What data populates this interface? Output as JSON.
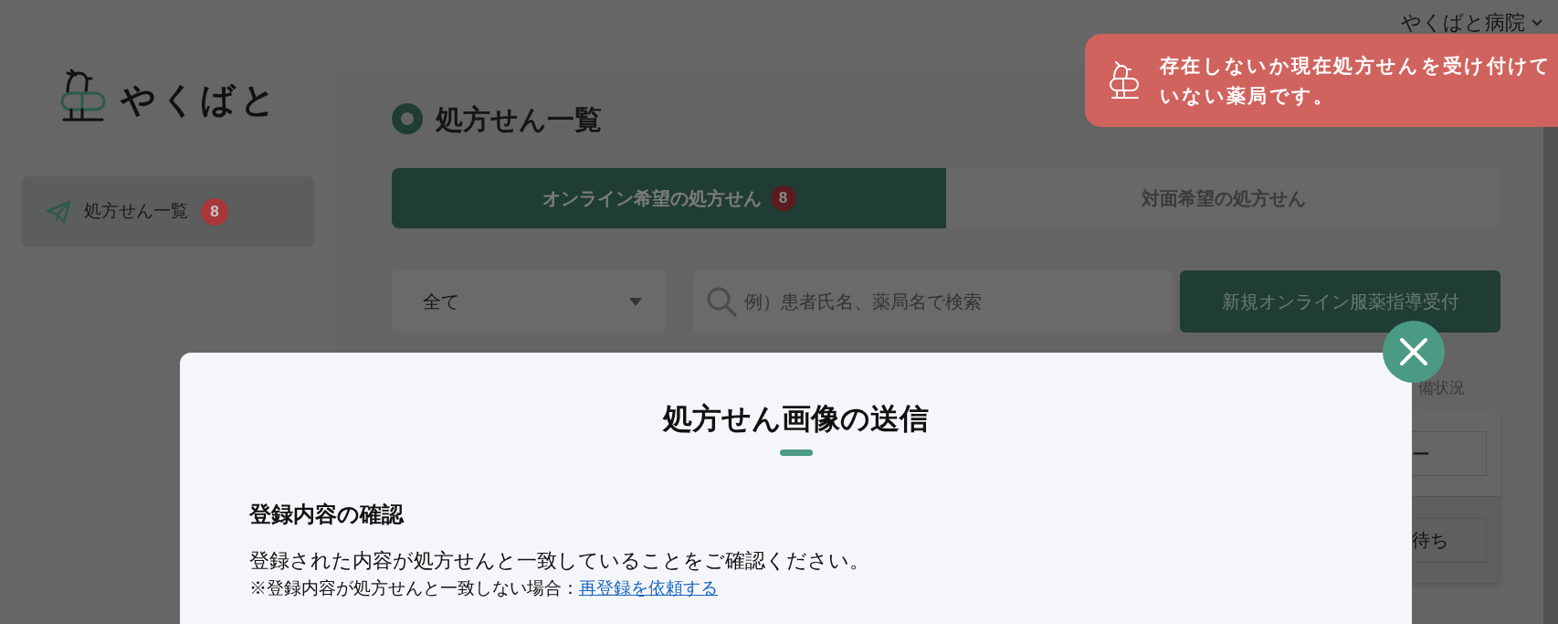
{
  "header": {
    "account": "やくばと病院"
  },
  "logo": {
    "text": "やくばと"
  },
  "sidebar": {
    "items": [
      {
        "label": "処方せん一覧",
        "badge": "8",
        "selected": true
      }
    ]
  },
  "page": {
    "title": "処方せん一覧",
    "tabs": [
      {
        "label": "オンライン希望の処方せん",
        "badge": "8",
        "selected": true
      },
      {
        "label": "対面希望の処方せん",
        "selected": false
      }
    ],
    "filter": {
      "value": "全て"
    },
    "search": {
      "placeholder": "例）患者氏名、薬局名で検索"
    },
    "new_button": "新規オンライン服薬指導受付",
    "table": {
      "column_header": "備状況",
      "cells": [
        "ー",
        "待ち"
      ]
    }
  },
  "modal": {
    "title": "処方せん画像の送信",
    "section_title": "登録内容の確認",
    "message": "登録された内容が処方せんと一致していることをご確認ください。",
    "note": "※登録内容が処方せんと一致しない場合：",
    "link": "再登録を依頼する"
  },
  "toast": {
    "message": "存在しないか現在処方せんを受け付けていない薬局です。"
  }
}
